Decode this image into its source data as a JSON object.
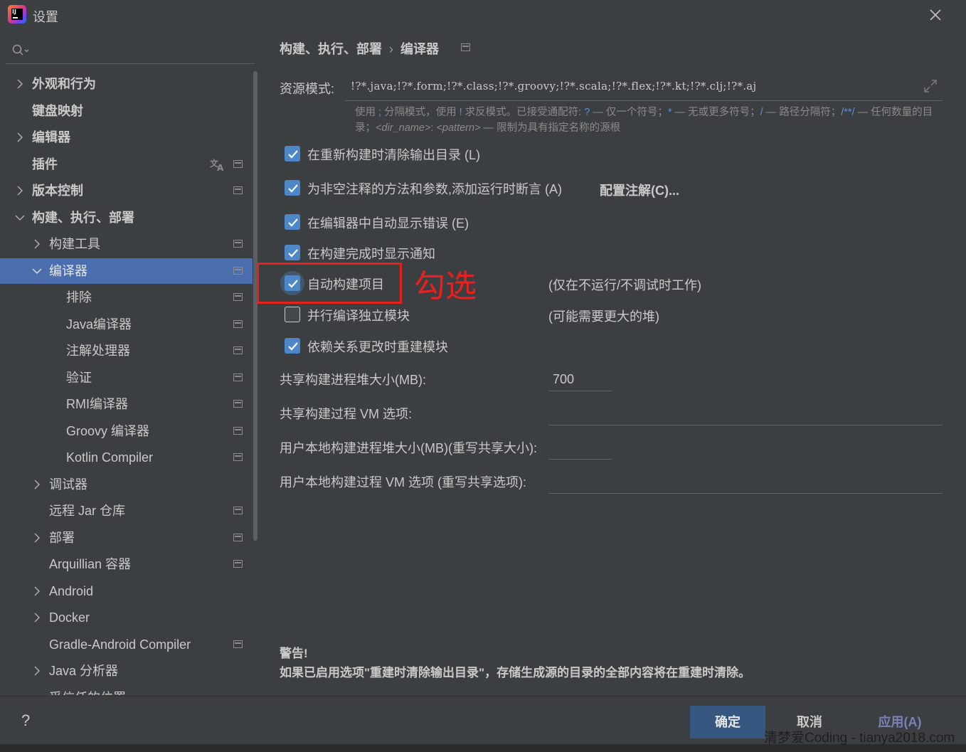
{
  "window": {
    "title": "设置"
  },
  "search": {
    "placeholder": ""
  },
  "sidebar": {
    "items": [
      {
        "label": "外观和行为"
      },
      {
        "label": "键盘映射"
      },
      {
        "label": "编辑器"
      },
      {
        "label": "插件"
      },
      {
        "label": "版本控制"
      },
      {
        "label": "构建、执行、部署"
      },
      {
        "label": "构建工具"
      },
      {
        "label": "编译器"
      },
      {
        "label": "排除"
      },
      {
        "label": "Java编译器"
      },
      {
        "label": "注解处理器"
      },
      {
        "label": "验证"
      },
      {
        "label": "RMI编译器"
      },
      {
        "label": "Groovy 编译器"
      },
      {
        "label": "Kotlin Compiler"
      },
      {
        "label": "调试器"
      },
      {
        "label": "远程 Jar 仓库"
      },
      {
        "label": "部署"
      },
      {
        "label": "Arquillian 容器"
      },
      {
        "label": "Android"
      },
      {
        "label": "Docker"
      },
      {
        "label": "Gradle-Android Compiler"
      },
      {
        "label": "Java 分析器"
      },
      {
        "label": "受信任的位置"
      }
    ]
  },
  "breadcrumb": {
    "parent": "构建、执行、部署",
    "separator": "›",
    "current": "编译器"
  },
  "resource_patterns": {
    "label": "资源模式:",
    "value": "!?*.java;!?*.form;!?*.class;!?*.groovy;!?*.scala;!?*.flex;!?*.kt;!?*.clj;!?*.aj",
    "help": {
      "p1": "使用 ",
      "semicolon": ";",
      "p2": " 分隔模式，使用 ",
      "bang": "!",
      "p3": " 求反模式。已接受通配符: ",
      "q": "?",
      "p4": " — 仅一个符号；",
      "star": "*",
      "p5": " — 无或更多符号；",
      "slash": "/",
      "p6": " — 路径分隔符；",
      "dstar": "/**/",
      "p7": " — 任何数量的目录；",
      "dir": "<dir_name>",
      "colon": ": ",
      "pattern": "<pattern>",
      "p8": " — 限制为具有指定名称的源根"
    }
  },
  "options": [
    {
      "label": "在重新构建时清除输出目录 (L)",
      "checked": true
    },
    {
      "label": "为非空注释的方法和参数,添加运行时断言 (A)",
      "checked": true
    },
    {
      "label": "在编辑器中自动显示错误 (E)",
      "checked": true
    },
    {
      "label": "在构建完成时显示通知",
      "checked": true
    },
    {
      "label": "自动构建项目",
      "checked": true,
      "hint": "(仅在不运行/不调试时工作)"
    },
    {
      "label": "并行编译独立模块",
      "checked": false,
      "hint": "(可能需要更大的堆)"
    },
    {
      "label": "依赖关系更改时重建模块",
      "checked": true
    }
  ],
  "configure_annotations": "配置注解(C)...",
  "annotation": {
    "text": "勾选",
    "color": "#e8201c"
  },
  "fields": {
    "shared_heap": {
      "label": "共享构建进程堆大小(MB):",
      "value": "700"
    },
    "shared_vm": {
      "label": "共享构建过程 VM 选项:",
      "value": ""
    },
    "user_heap": {
      "label": "用户本地构建进程堆大小(MB)(重写共享大小):",
      "value": ""
    },
    "user_vm": {
      "label": "用户本地构建过程 VM 选项 (重写共享选项):",
      "value": ""
    }
  },
  "warning": {
    "title": "警告!",
    "text": "如果已启用选项\"重建时清除输出目录\"，存储生成源的目录的全部内容将在重建时清除。"
  },
  "footer": {
    "help": "?",
    "ok": "确定",
    "cancel": "取消",
    "apply": "应用(A)"
  },
  "watermark": "清梦爱Coding - tianya2018.com",
  "colors": {
    "accent": "#4b6eaf",
    "checkbox": "#4c87c8",
    "primary_button": "#365880",
    "background": "#3c3f41"
  }
}
